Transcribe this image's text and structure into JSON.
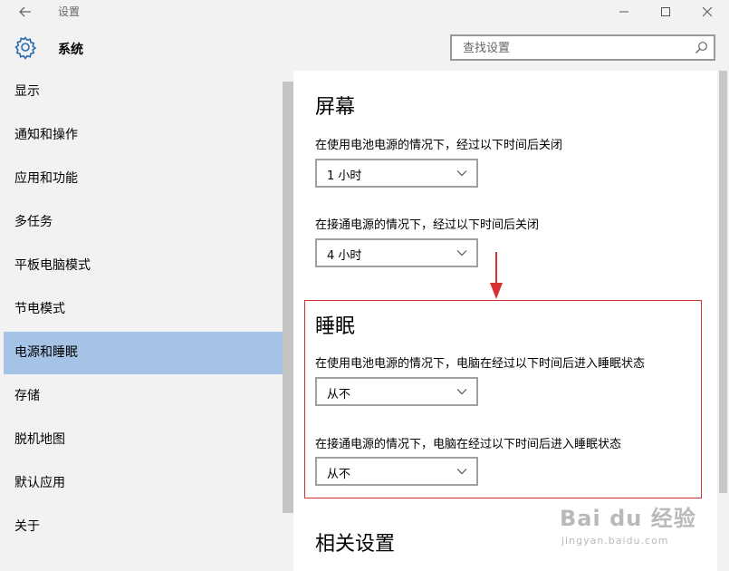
{
  "window": {
    "title": "设置",
    "back_icon": "back-arrow-icon",
    "controls": [
      "minimize-icon",
      "maximize-icon",
      "close-icon"
    ]
  },
  "header": {
    "icon": "gear-icon",
    "section": "系统",
    "search": {
      "placeholder": "查找设置",
      "value": "",
      "icon": "search-icon"
    }
  },
  "sidebar": {
    "items": [
      {
        "label": "显示",
        "active": false
      },
      {
        "label": "通知和操作",
        "active": false
      },
      {
        "label": "应用和功能",
        "active": false
      },
      {
        "label": "多任务",
        "active": false
      },
      {
        "label": "平板电脑模式",
        "active": false
      },
      {
        "label": "节电模式",
        "active": false
      },
      {
        "label": "电源和睡眠",
        "active": true
      },
      {
        "label": "存储",
        "active": false
      },
      {
        "label": "脱机地图",
        "active": false
      },
      {
        "label": "默认应用",
        "active": false
      },
      {
        "label": "关于",
        "active": false
      }
    ]
  },
  "main": {
    "screen": {
      "title": "屏幕",
      "battery_label": "在使用电池电源的情况下，经过以下时间后关闭",
      "battery_value": "1 小时",
      "plugged_label": "在接通电源的情况下，经过以下时间后关闭",
      "plugged_value": "4 小时"
    },
    "sleep": {
      "title": "睡眠",
      "battery_label": "在使用电池电源的情况下，电脑在经过以下时间后进入睡眠状态",
      "battery_value": "从不",
      "plugged_label": "在接通电源的情况下，电脑在经过以下时间后进入睡眠状态",
      "plugged_value": "从不"
    },
    "related": {
      "title": "相关设置"
    }
  },
  "watermark": {
    "main": "Bai du 经验",
    "sub": "jingyan.baidu.com"
  },
  "colors": {
    "sidebar_bg": "#f2f2f2",
    "active_item": "#a4c3e7",
    "highlight_box": "#d83030",
    "accent_icon": "#2b6cb0"
  }
}
